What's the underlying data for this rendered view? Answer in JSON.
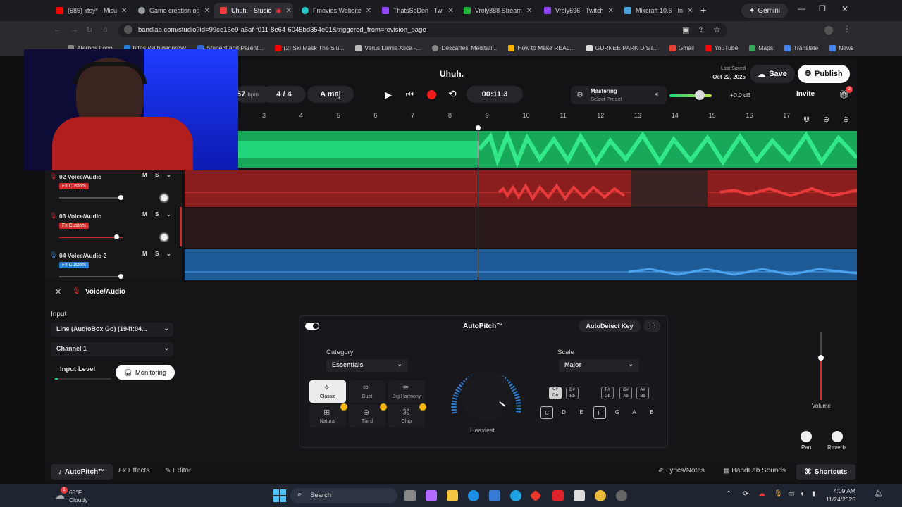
{
  "browser": {
    "tabs": [
      {
        "label": "(585) xtsy* - Misu",
        "favicon_color": "#ff0000"
      },
      {
        "label": "Game creation op",
        "favicon_color": "#9aa0a6"
      },
      {
        "label": "Uhuh. - Studio",
        "favicon_color": "#f23b3b"
      },
      {
        "label": "Fmovies Website",
        "favicon_color": "#2bc4c4"
      },
      {
        "label": "ThatsSoDori - Twi",
        "favicon_color": "#9146ff"
      },
      {
        "label": "Vroly888 Stream",
        "favicon_color": "#1fb53d"
      },
      {
        "label": "Vroly696 - Twitch",
        "favicon_color": "#9146ff"
      },
      {
        "label": "Mixcraft 10.6 - In",
        "favicon_color": "#4aa3df"
      }
    ],
    "gemini_label": "Gemini",
    "url": "bandlab.com/studio?id=99ce16e9-a6af-f011-8e64-6045bd354e91&triggered_from=revision_page",
    "bookmarks": [
      "Aternos Logo",
      "https://sl.hidenproxy",
      "Student and Parent...",
      "(2) Ski Mask The Slu...",
      "Verus Lamia Alica -...",
      "Descartes' Meditati...",
      "How to Make REAL...",
      "GURNEE PARK DIST...",
      "Gmail",
      "YouTube",
      "Maps",
      "Translate",
      "News"
    ]
  },
  "studio": {
    "project_title": "Uhuh.",
    "last_saved_label": "Last Saved",
    "last_saved_date": "Oct 22, 2025",
    "save_label": "Save",
    "publish_label": "Publish",
    "invite_label": "Invite",
    "gift_badge": "3",
    "bpm_value": "57",
    "bpm_unit": "bpm",
    "time_signature": "4 / 4",
    "key": "A maj",
    "time_display": "00:11.3",
    "mastering_label": "Mastering",
    "mastering_sub": "Select Preset",
    "master_volume": "+0.0 dB",
    "ruler_ticks": [
      "3",
      "4",
      "5",
      "6",
      "7",
      "8",
      "9",
      "10",
      "11",
      "12",
      "13",
      "14",
      "15",
      "16",
      "17"
    ],
    "tracks": [
      {
        "name": "02 Voice/Audio",
        "fx": "Fx Custom",
        "color": "#d42828"
      },
      {
        "name": "03 Voice/Audio",
        "fx": "Fx Custom",
        "color": "#d42828"
      },
      {
        "name": "04 Voice/Audio 2",
        "fx": "Fx Custom",
        "color": "#2a7fd4"
      }
    ],
    "mute_label": "M",
    "solo_label": "S"
  },
  "panel": {
    "track_label": "Voice/Audio",
    "input_label": "Input",
    "input_device": "Line (AudioBox Go) (194f:04...",
    "channel": "Channel 1",
    "input_level_label": "Input Level",
    "monitoring_label": "Monitoring",
    "autopitch": {
      "title": "AutoPitch™",
      "autodetect_label": "AutoDetect Key",
      "category_label": "Category",
      "category_value": "Essentials",
      "styles": [
        "Classic",
        "Duet",
        "Big Harmony",
        "Natural",
        "Third",
        "Chip"
      ],
      "amount_label": "Heaviest",
      "scale_label": "Scale",
      "scale_value": "Major",
      "sharps": [
        "C#\nDb",
        "D#\nEb",
        "F#\nGb",
        "G#\nAb",
        "A#\nBb"
      ],
      "naturals": [
        "C",
        "D",
        "E",
        "F",
        "G",
        "A",
        "B"
      ]
    },
    "volume_label": "Volume",
    "pan_label": "Pan",
    "reverb_label": "Reverb"
  },
  "bottom_nav": {
    "autopitch": "AutoPitch™",
    "effects": "Effects",
    "editor": "Editor",
    "lyrics": "Lyrics/Notes",
    "sounds": "BandLab Sounds",
    "shortcuts": "Shortcuts"
  },
  "taskbar": {
    "weather_temp": "68°F",
    "weather_desc": "Cloudy",
    "search_label": "Search",
    "time": "4:09 AM",
    "date": "11/24/2025",
    "notif_badge": "1"
  }
}
